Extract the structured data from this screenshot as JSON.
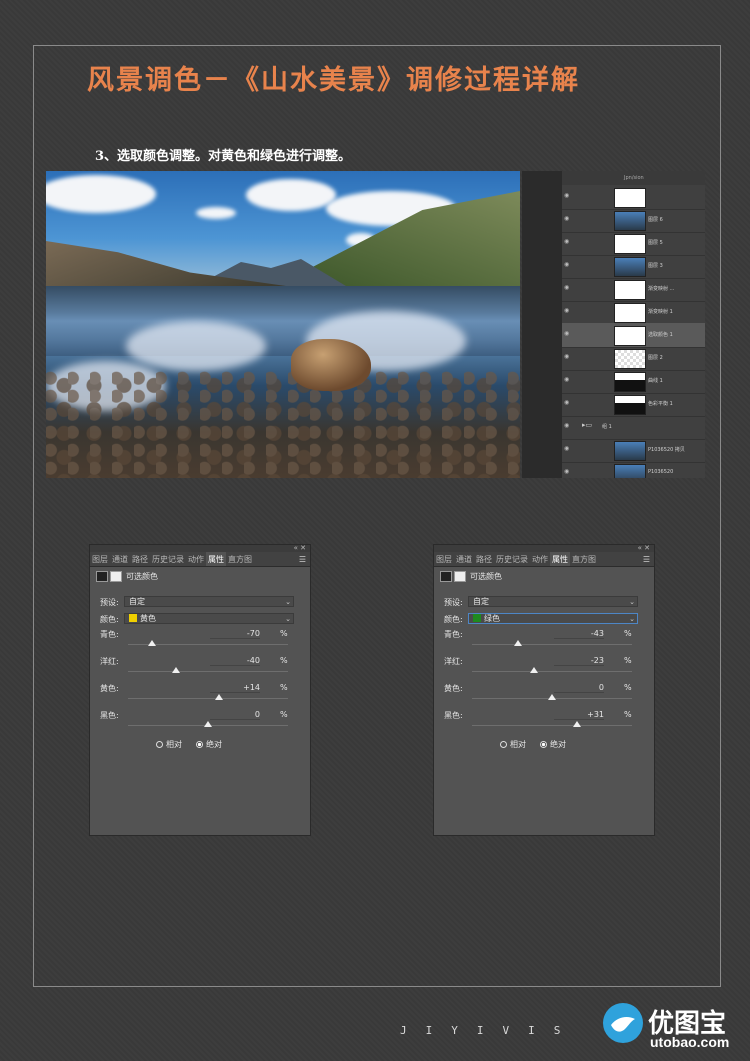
{
  "title": "风景调色－《山水美景》调修过程详解",
  "step": "3、选取颜色调整。对黄色和绿色进行调整。",
  "layers_panel": {
    "header": "Jpn/sion",
    "rows": [
      {
        "name": "",
        "thumb": "white"
      },
      {
        "name": "图层 6",
        "thumb": "photo"
      },
      {
        "name": "图层 5",
        "thumb": "white"
      },
      {
        "name": "图层 3",
        "thumb": "photo"
      },
      {
        "name": "渐变映射 ...",
        "thumb": "white"
      },
      {
        "name": "渐变映射 1",
        "thumb": "white"
      },
      {
        "name": "选取颜色 1",
        "thumb": "white",
        "selected": true
      },
      {
        "name": "图层 2",
        "thumb": "checker"
      },
      {
        "name": "曲线 1",
        "thumb": "mask"
      },
      {
        "name": "色彩平衡 1",
        "thumb": "mask"
      },
      {
        "name": "组 1",
        "thumb": "none"
      },
      {
        "name": "P1036520 拷贝",
        "thumb": "photo"
      },
      {
        "name": "P1036520",
        "thumb": "photo"
      }
    ]
  },
  "panels": [
    {
      "tabs": [
        "图层",
        "通道",
        "路径",
        "历史记录",
        "动作",
        "属性",
        "直方图"
      ],
      "active_tab": "属性",
      "title": "可选颜色",
      "preset_label": "预设:",
      "preset_value": "自定",
      "color_label": "颜色:",
      "color_value": "黄色",
      "swatch": "#f0d000",
      "sliders": [
        {
          "label": "青色:",
          "value": "-70",
          "pct": "%",
          "num": -70
        },
        {
          "label": "洋红:",
          "value": "-40",
          "pct": "%",
          "num": -40
        },
        {
          "label": "黄色:",
          "value": "+14",
          "pct": "%",
          "num": 14
        },
        {
          "label": "黑色:",
          "value": "0",
          "pct": "%",
          "num": 0
        }
      ],
      "radio_relative": "相对",
      "radio_absolute": "绝对",
      "selected_radio": "absolute"
    },
    {
      "tabs": [
        "图层",
        "通道",
        "路径",
        "历史记录",
        "动作",
        "属性",
        "直方图"
      ],
      "active_tab": "属性",
      "title": "可选颜色",
      "preset_label": "预设:",
      "preset_value": "自定",
      "color_label": "颜色:",
      "color_value": "绿色",
      "swatch": "#1f8a1f",
      "sliders": [
        {
          "label": "青色:",
          "value": "-43",
          "pct": "%",
          "num": -43
        },
        {
          "label": "洋红:",
          "value": "-23",
          "pct": "%",
          "num": -23
        },
        {
          "label": "黄色:",
          "value": "0",
          "pct": "%",
          "num": 0
        },
        {
          "label": "黑色:",
          "value": "+31",
          "pct": "%",
          "num": 31
        }
      ],
      "radio_relative": "相对",
      "radio_absolute": "绝对",
      "selected_radio": "absolute"
    }
  ],
  "footer_brand": "JIYIVIS",
  "watermark": {
    "cn": "优图宝",
    "url": "utobao.com"
  },
  "colors": {
    "title": "#e8834c",
    "accent_blue": "#4d86c6"
  }
}
